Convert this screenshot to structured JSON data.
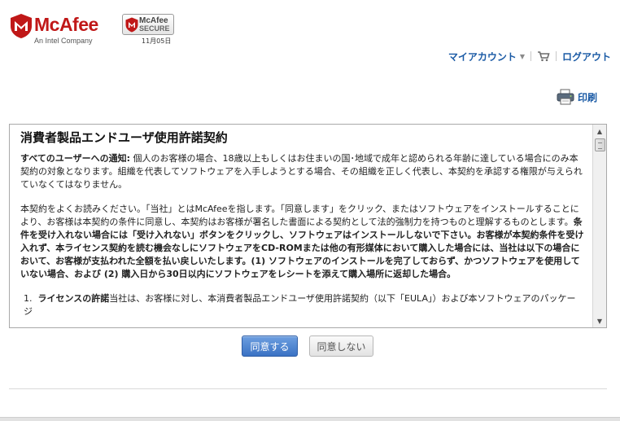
{
  "header": {
    "brand": "McAfee",
    "tagline": "An Intel Company",
    "secure_badge": {
      "line1": "McAfee",
      "line2": "SECURE",
      "date": "11月05日"
    }
  },
  "topnav": {
    "account": "マイアカウント",
    "logout": "ログアウト"
  },
  "print": {
    "label": "印刷"
  },
  "eula": {
    "title": "消費者製品エンドユーザ使用許諾契約",
    "notice_bold": "すべてのユーザーへの通知:",
    "notice_text": " 個人のお客様の場合、18歳以上もしくはお住まいの国･地域で成年と認められる年齢に達している場合にのみ本契約の対象となります。組織を代表してソフトウェアを入手しようとする場合、その組織を正しく代表し、本契約を承認する権限が与えられていなくてはなりません。",
    "para2_text": "本契約をよくお読みください。「当社」とはMcAfeeを指します。「同意します」をクリック、またはソフトウェアをインストールすることにより、お客様は本契約の条件に同意し、本契約はお客様が署名した書面による契約として法的強制力を持つものと理解するものとします。",
    "para2_bold": "条件を受け入れない場合には「受け入れない」ボタンをクリックし、ソフトウェアはインストールしないで下さい。お客様が本契約条件を受け入れず、本ライセンス契約を読む機会なしにソフトウェアをCD-ROMまたは他の有形媒体において購入した場合には、当社は以下の場合において、お客様が支払われた全額を払い戻しいたします。(1) ソフトウェアのインストールを完了しておらず、かつソフトウェアを使用していない場合、および (2) 購入日から30日以内にソフトウェアをレシートを添えて購入場所に返却した場合。",
    "item1_number": "1.",
    "item1_bold": "ライセンスの許諾",
    "item1_text": "当社は、お客様に対し、本消費者製品エンドユーザ使用許諾契約（以下「EULA」）および本ソフトウェアのパッケージ"
  },
  "buttons": {
    "agree": "同意する",
    "decline": "同意しない"
  },
  "colors": {
    "brand_red": "#c01818",
    "link_blue": "#1a5aa5",
    "primary_button": "#3a72c4"
  }
}
